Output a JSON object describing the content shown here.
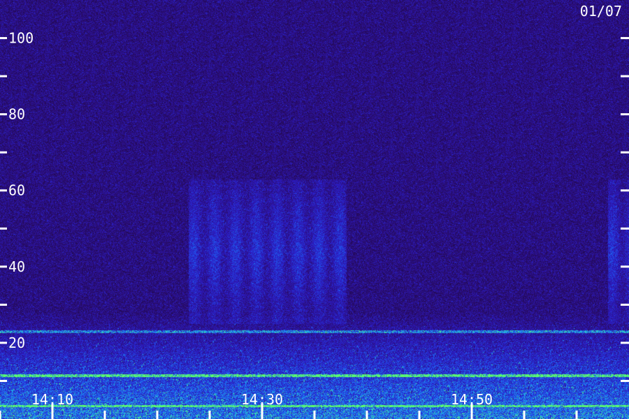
{
  "chart_data": {
    "type": "heatmap",
    "title": "",
    "date_label": "01/07",
    "xlabel": "",
    "ylabel": "",
    "ylim": [
      0,
      110
    ],
    "yticks": [
      {
        "value": 20,
        "label": "20"
      },
      {
        "value": 40,
        "label": "40"
      },
      {
        "value": 60,
        "label": "60"
      },
      {
        "value": 80,
        "label": "80"
      },
      {
        "value": 100,
        "label": "100"
      }
    ],
    "y_minor_ticks": [
      10,
      30,
      50,
      70,
      90
    ],
    "x_range": [
      "14:05",
      "15:05"
    ],
    "xticks": [
      {
        "value": "14:10",
        "label": "14:10"
      },
      {
        "value": "14:30",
        "label": "14:30"
      },
      {
        "value": "14:50",
        "label": "14:50"
      }
    ],
    "x_minor_ticks": [
      "14:05",
      "14:15",
      "14:20",
      "14:25",
      "14:35",
      "14:40",
      "14:45",
      "14:55",
      "15:00"
    ],
    "background_color": "#1e0b3d",
    "colormap": [
      "#12062a",
      "#2a0c6e",
      "#2c1cc4",
      "#1f5cf0",
      "#20b6e6",
      "#5dff6a"
    ],
    "features": [
      {
        "kind": "broadband-noise",
        "y_range": [
          0,
          28
        ],
        "intensity": 0.55
      },
      {
        "kind": "horizontal-line",
        "y": 23,
        "intensity": 0.55
      },
      {
        "kind": "horizontal-line",
        "y": 11.5,
        "intensity": 0.9
      },
      {
        "kind": "horizontal-line",
        "y": 3.5,
        "intensity": 0.75
      },
      {
        "kind": "vertical-bursts",
        "x_range": [
          "14:23",
          "14:38"
        ],
        "y_range": [
          25,
          63
        ],
        "intensity": 0.3
      },
      {
        "kind": "vertical-bursts",
        "x_range": [
          "15:03",
          "15:05"
        ],
        "y_range": [
          25,
          63
        ],
        "intensity": 0.3
      }
    ]
  }
}
